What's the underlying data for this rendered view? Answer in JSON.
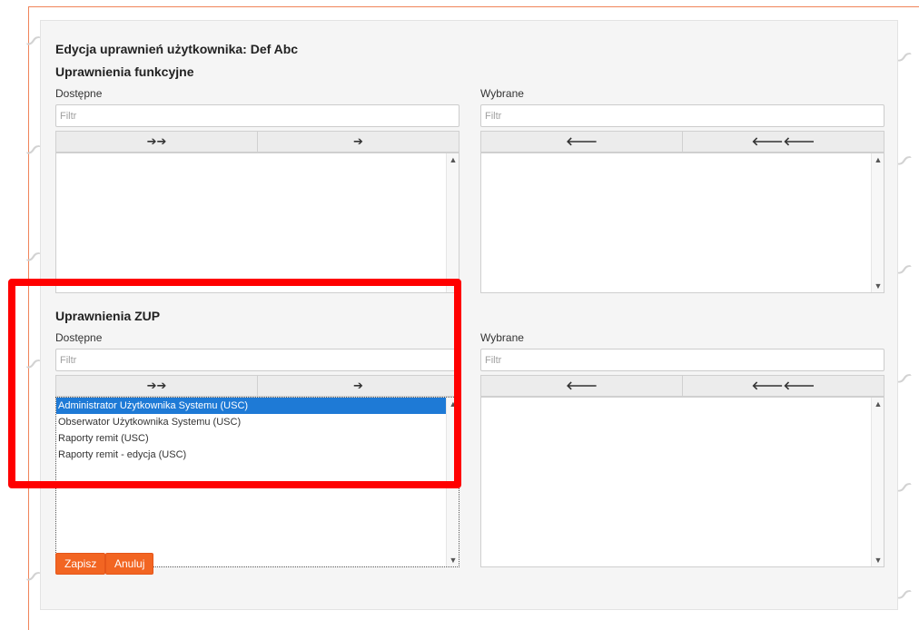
{
  "page": {
    "title": "Edycja uprawnień użytkownika: Def Abc"
  },
  "functional": {
    "section_title": "Uprawnienia funkcyjne",
    "available_label": "Dostępne",
    "selected_label": "Wybrane",
    "available_filter_placeholder": "Filtr",
    "selected_filter_placeholder": "Filtr",
    "move_all_right": "➔➔",
    "move_right": "➔",
    "move_left": "🡐",
    "move_all_left": "🡐🡐",
    "available_items": [],
    "selected_items": []
  },
  "zup": {
    "section_title": "Uprawnienia ZUP",
    "available_label": "Dostępne",
    "selected_label": "Wybrane",
    "available_filter_placeholder": "Filtr",
    "selected_filter_placeholder": "Filtr",
    "move_all_right": "➔➔",
    "move_right": "➔",
    "move_left": "🡐",
    "move_all_left": "🡐🡐",
    "available_items": [
      {
        "label": "Administrator Użytkownika Systemu (USC)",
        "selected": true
      },
      {
        "label": "Obserwator Użytkownika Systemu (USC)",
        "selected": false
      },
      {
        "label": "Raporty remit (USC)",
        "selected": false
      },
      {
        "label": "Raporty remit - edycja (USC)",
        "selected": false
      }
    ],
    "selected_items": []
  },
  "actions": {
    "save_label": "Zapisz",
    "cancel_label": "Anuluj"
  },
  "colors": {
    "accent": "#f26522",
    "selection": "#1e7ad6",
    "highlight": "#ff0000"
  },
  "icons": {
    "scroll_up": "chevron-up-icon",
    "scroll_down": "chevron-down-icon",
    "watermark": "logo-watermark-icon"
  }
}
